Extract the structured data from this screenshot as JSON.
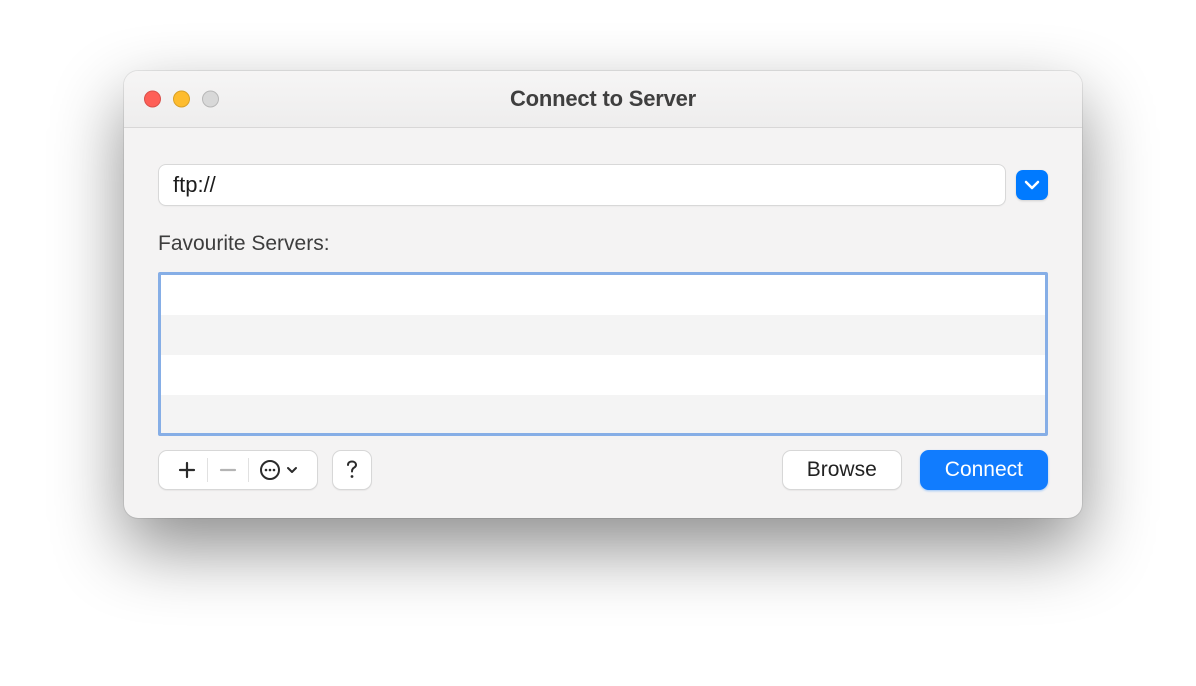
{
  "window": {
    "title": "Connect to Server"
  },
  "address": {
    "value": "ftp://"
  },
  "favourites": {
    "label": "Favourite Servers:",
    "items": []
  },
  "toolbar": {
    "add_icon": "plus",
    "remove_icon": "minus",
    "options_icon": "ellipsis-circle",
    "help_icon": "question"
  },
  "buttons": {
    "browse": "Browse",
    "connect": "Connect"
  },
  "colors": {
    "accent": "#117cfe",
    "focus_ring": "#86aee6"
  }
}
